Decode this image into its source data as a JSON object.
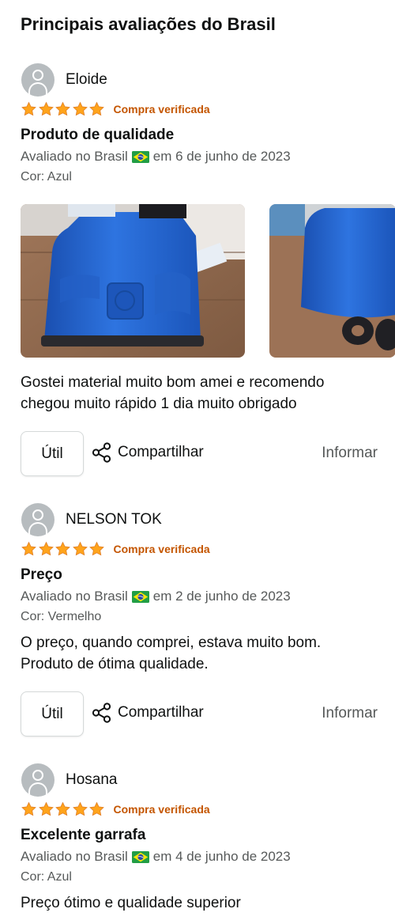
{
  "section_title": "Principais avaliações do Brasil",
  "colors": {
    "star": "#ffa41c",
    "verified": "#c45500",
    "meta": "#565959",
    "text": "#0f1111"
  },
  "reviews": [
    {
      "reviewer": "Eloide",
      "rating": 5,
      "verified": "Compra verificada",
      "title": "Produto de qualidade",
      "meta_prefix": "Avaliado no Brasil",
      "meta_suffix": "em 6 de junho de 2023",
      "color": "Cor: Azul",
      "body": "Gostei material muito bom amei e recomendo chegou muito rápido 1 dia muito obrigado",
      "useful": "Útil",
      "share": "Compartilhar",
      "report": "Informar",
      "images": [
        "blue-water-jug-photo-1",
        "blue-water-jug-photo-2"
      ]
    },
    {
      "reviewer": "NELSON TOK",
      "rating": 5,
      "verified": "Compra verificada",
      "title": "Preço",
      "meta_prefix": "Avaliado no Brasil",
      "meta_suffix": "em 2 de junho de 2023",
      "color": "Cor: Vermelho",
      "body": "O preço, quando comprei, estava muito bom. Produto de ótima qualidade.",
      "useful": "Útil",
      "share": "Compartilhar",
      "report": "Informar"
    },
    {
      "reviewer": "Hosana",
      "rating": 5,
      "verified": "Compra verificada",
      "title": "Excelente garrafa",
      "meta_prefix": "Avaliado no Brasil",
      "meta_suffix": "em 4 de junho de 2023",
      "color": "Cor: Azul",
      "body": "Preço ótimo e qualidade superior"
    }
  ]
}
